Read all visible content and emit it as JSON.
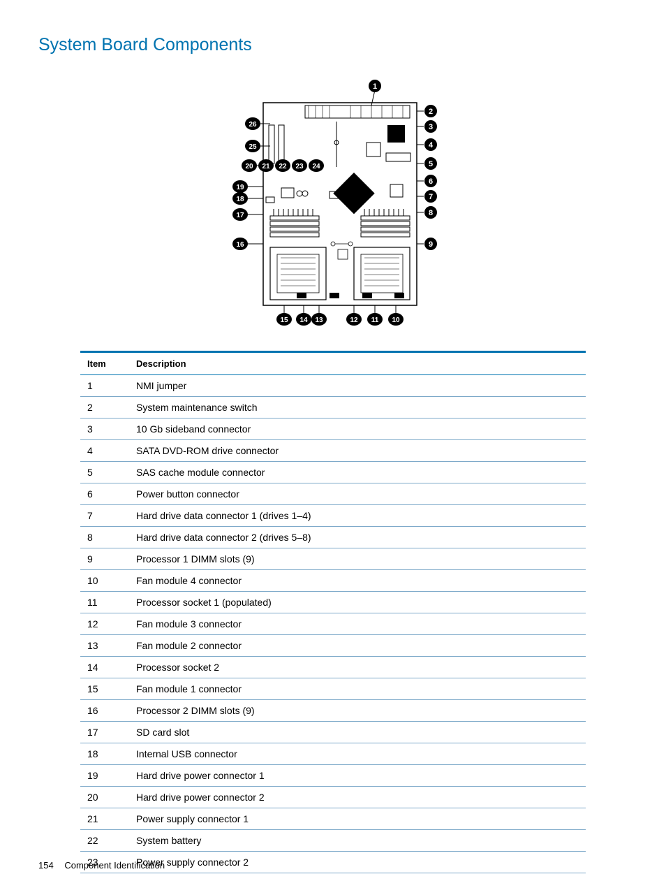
{
  "title": "System Board Components",
  "footer": {
    "page_number": "154",
    "section_label": "Component Identification"
  },
  "table": {
    "headers": {
      "item": "Item",
      "description": "Description"
    },
    "rows": [
      {
        "item": "1",
        "description": "NMI jumper"
      },
      {
        "item": "2",
        "description": "System maintenance switch"
      },
      {
        "item": "3",
        "description": "10 Gb sideband connector"
      },
      {
        "item": "4",
        "description": "SATA DVD-ROM drive connector"
      },
      {
        "item": "5",
        "description": "SAS cache module connector"
      },
      {
        "item": "6",
        "description": "Power button connector"
      },
      {
        "item": "7",
        "description": "Hard drive data connector 1 (drives 1–4)"
      },
      {
        "item": "8",
        "description": "Hard drive data connector 2 (drives 5–8)"
      },
      {
        "item": "9",
        "description": "Processor 1 DIMM slots (9)"
      },
      {
        "item": "10",
        "description": "Fan module 4 connector"
      },
      {
        "item": "11",
        "description": "Processor socket 1 (populated)"
      },
      {
        "item": "12",
        "description": "Fan module 3 connector"
      },
      {
        "item": "13",
        "description": "Fan module 2 connector"
      },
      {
        "item": "14",
        "description": "Processor socket 2"
      },
      {
        "item": "15",
        "description": "Fan module 1 connector"
      },
      {
        "item": "16",
        "description": "Processor 2 DIMM slots (9)"
      },
      {
        "item": "17",
        "description": "SD card slot"
      },
      {
        "item": "18",
        "description": "Internal USB connector"
      },
      {
        "item": "19",
        "description": "Hard drive power connector 1"
      },
      {
        "item": "20",
        "description": "Hard drive power connector 2"
      },
      {
        "item": "21",
        "description": "Power supply connector 1"
      },
      {
        "item": "22",
        "description": "System battery"
      },
      {
        "item": "23",
        "description": "Power supply connector 2"
      }
    ]
  },
  "diagram": {
    "callouts": [
      "1",
      "2",
      "3",
      "4",
      "5",
      "6",
      "7",
      "8",
      "9",
      "10",
      "11",
      "12",
      "13",
      "14",
      "15",
      "16",
      "17",
      "18",
      "19",
      "20",
      "21",
      "22",
      "23",
      "24",
      "25",
      "26"
    ]
  }
}
